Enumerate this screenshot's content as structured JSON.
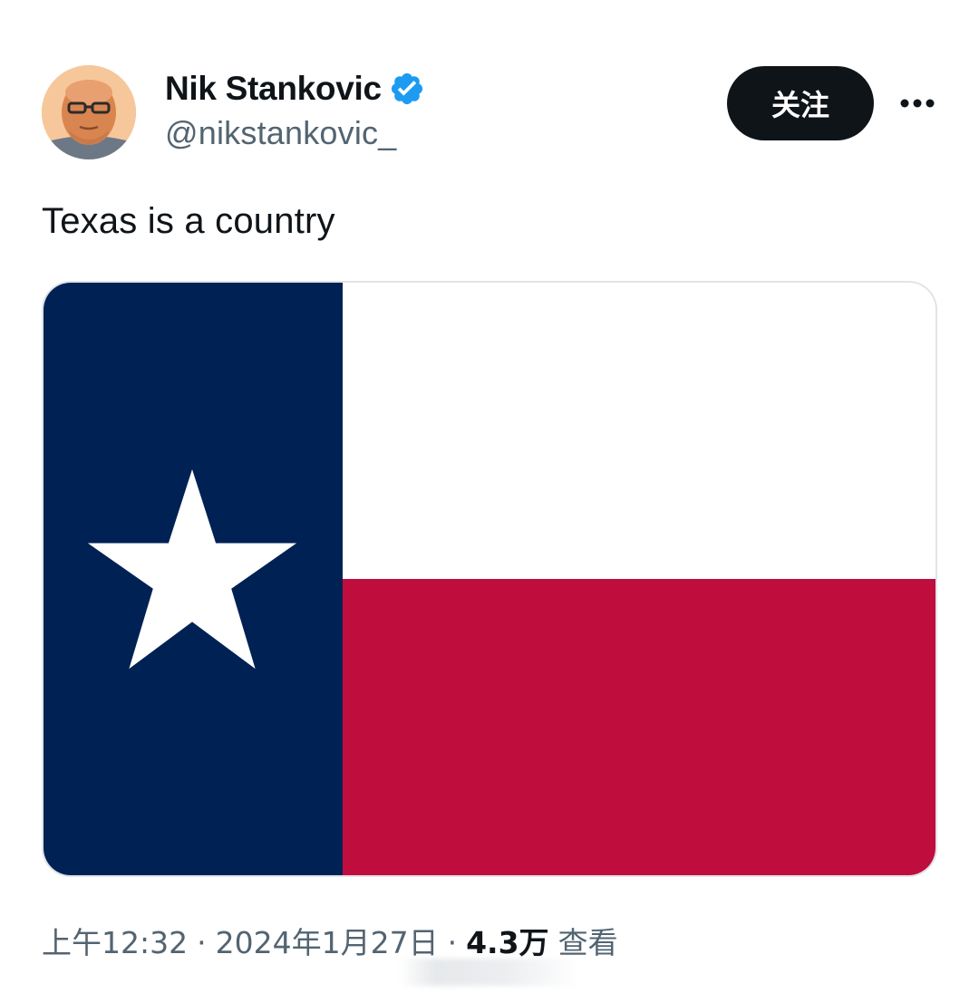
{
  "author": {
    "display_name": "Nik Stankovic",
    "handle": "@nikstankovic_",
    "verified": true,
    "avatar_icon": "profile-photo-avatar"
  },
  "actions": {
    "follow_label": "关注",
    "more_icon": "more-horizontal-icon"
  },
  "tweet": {
    "text": "Texas is a country",
    "media": {
      "description_icon": "texas-flag-image",
      "colors": {
        "blue": "#002154",
        "white": "#ffffff",
        "red": "#bf0d3e"
      }
    }
  },
  "meta": {
    "time": "上午12:32",
    "separator": "·",
    "date": "2024年1月27日",
    "views_count": "4.3万",
    "views_label": "查看"
  },
  "colors": {
    "text_primary": "#0f1419",
    "text_secondary": "#536471",
    "verified_blue": "#1d9bf0",
    "follow_button_bg": "#0f1419",
    "follow_button_text": "#ffffff"
  }
}
